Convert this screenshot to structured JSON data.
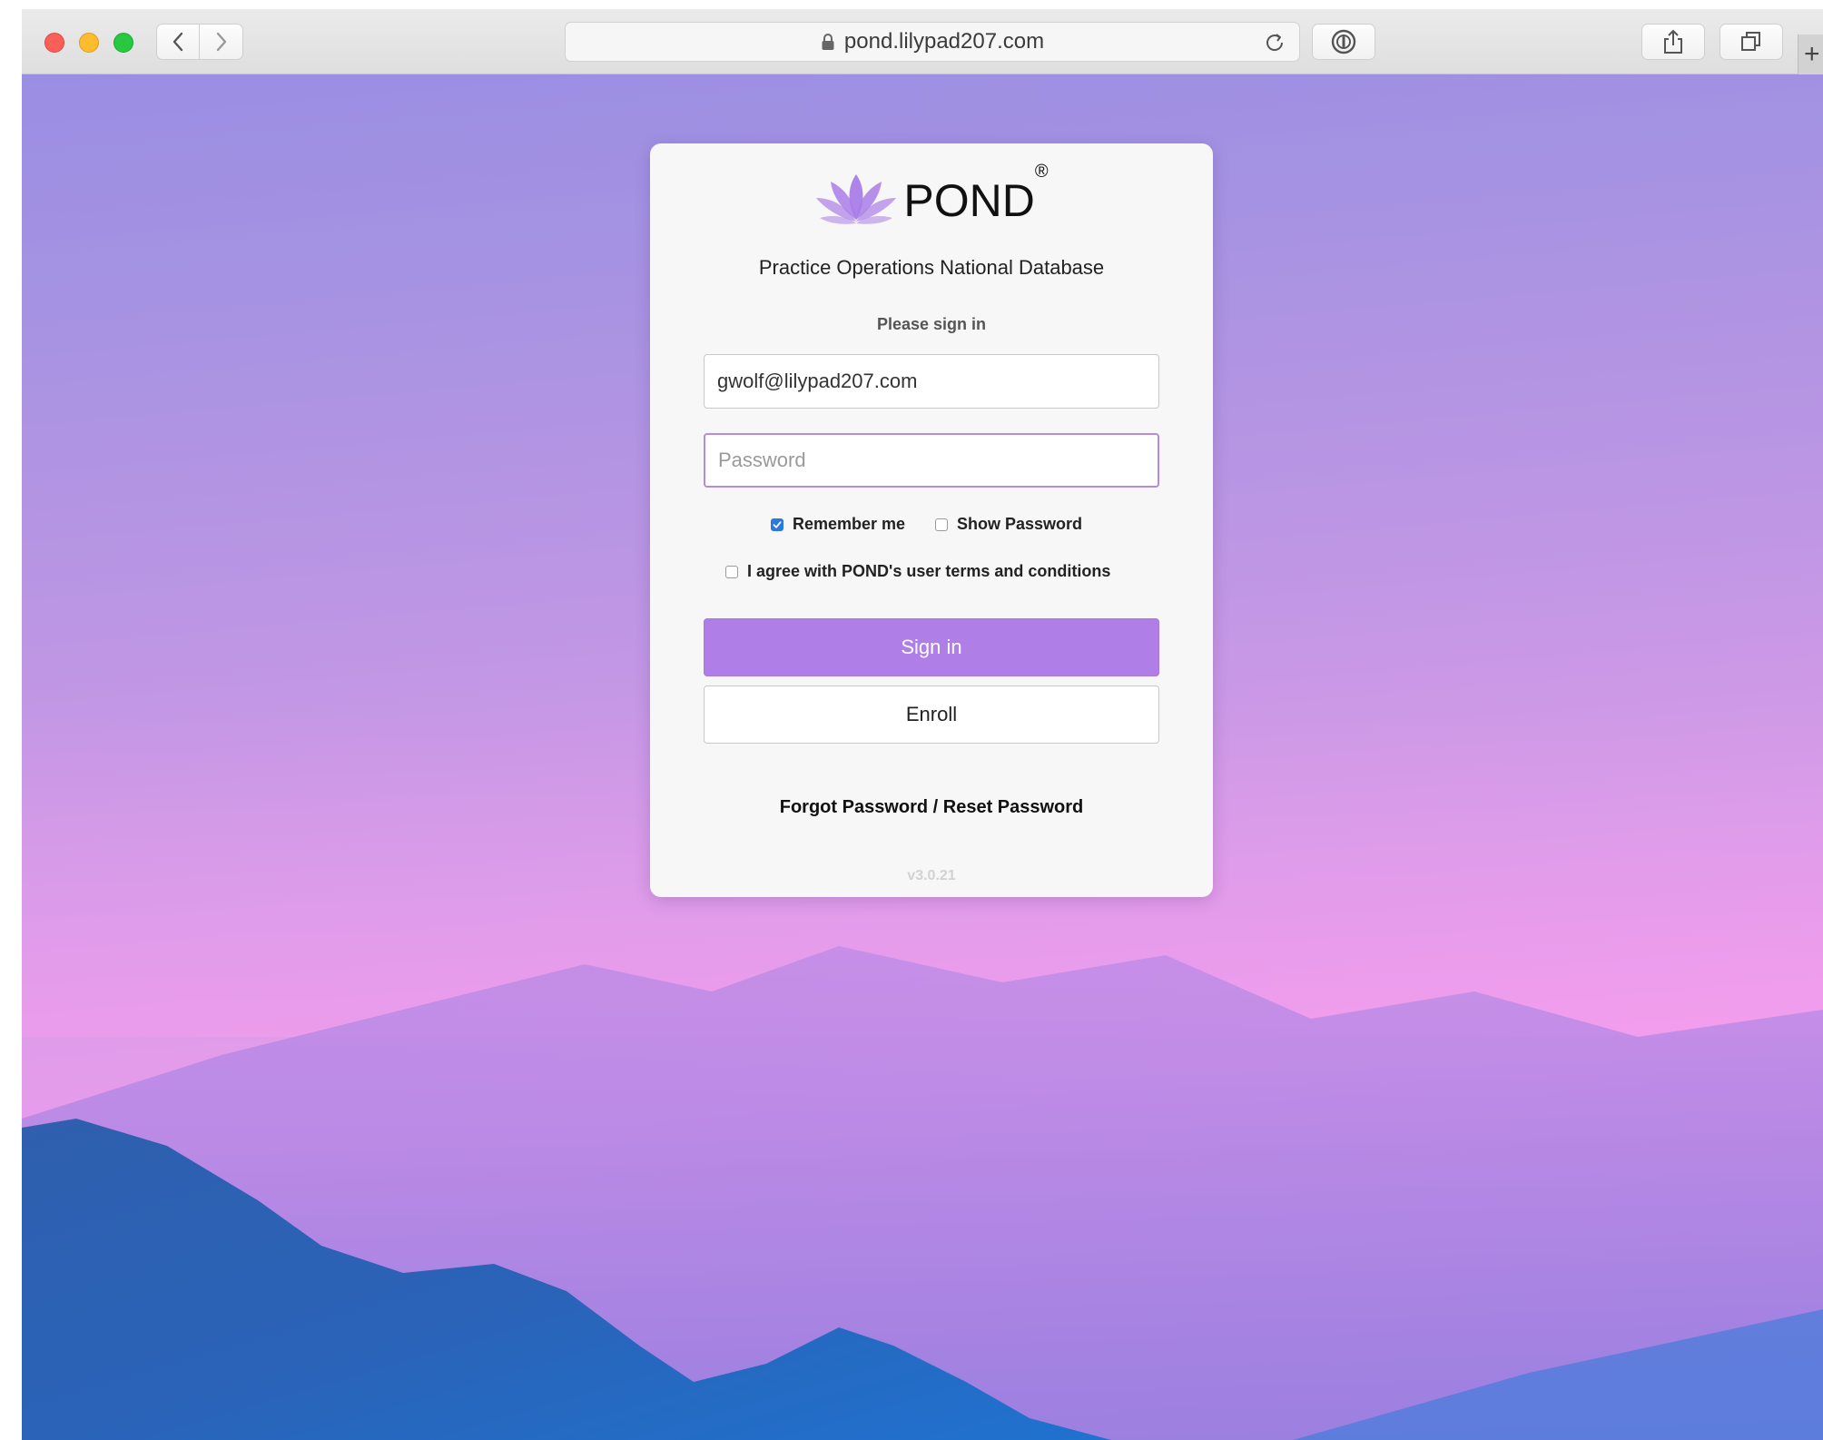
{
  "browser": {
    "url": "pond.lilypad207.com",
    "new_tab_symbol": "+"
  },
  "app": {
    "logo_text": "POND",
    "logo_reg": "®",
    "subtitle": "Practice Operations National Database",
    "brand_color": "#af7ee6"
  },
  "login": {
    "heading": "Please sign in",
    "email_value": "gwolf@lilypad207.com",
    "password_placeholder": "Password",
    "remember_label": "Remember me",
    "remember_checked": true,
    "show_password_label": "Show Password",
    "show_password_checked": false,
    "agree_label": "I agree with POND's user terms and conditions",
    "agree_checked": false,
    "signin_label": "Sign in",
    "enroll_label": "Enroll",
    "forgot_label": "Forgot Password / Reset Password",
    "version": "v3.0.21"
  },
  "icons": {
    "lock": "lock-icon",
    "reload": "reload-icon",
    "back": "chevron-left-icon",
    "forward": "chevron-right-icon",
    "password_manager": "password-manager-icon",
    "share": "share-icon",
    "tabs": "tabs-overview-icon",
    "logo": "lotus-icon",
    "check": "checkmark-icon"
  }
}
